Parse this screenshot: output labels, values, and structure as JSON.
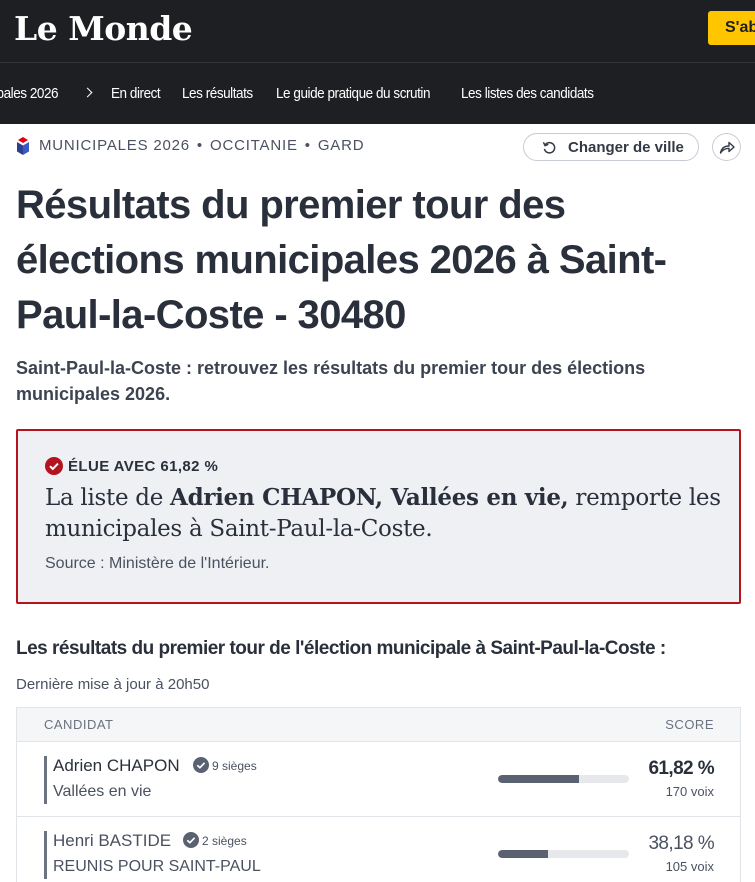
{
  "header": {
    "logo": "Le Monde",
    "subscribe_label": "S'ab"
  },
  "nav": {
    "items": [
      {
        "label": "ipales 2026"
      },
      {
        "label": "En direct"
      },
      {
        "label": "Les résultats"
      },
      {
        "label": "Le guide pratique du scrutin"
      },
      {
        "label": "Les listes des candidats"
      }
    ]
  },
  "breadcrumb": {
    "items": [
      "MUNICIPALES 2026",
      "OCCITANIE",
      "GARD"
    ],
    "separator": "•"
  },
  "actions": {
    "change_city_label": "Changer de ville"
  },
  "page": {
    "title_prefix": "Résultats du premier tour des élections municipales 2026 à ",
    "title_city": "Saint-Paul-la-Coste",
    "title_suffix": " - 30480",
    "subtitle": "Saint-Paul-la-Coste : retrouvez les résultats du premier tour des élections municipales 2026."
  },
  "elected": {
    "label": "ÉLUE AVEC 61,82 %",
    "text_prefix": "La liste de ",
    "text_bold": "Adrien CHAPON, Vallées en vie,",
    "text_suffix": " remporte les municipales à Saint-Paul-la-Coste.",
    "source": "Source : Ministère de l'Intérieur.",
    "accent_color": "#b3141d"
  },
  "results": {
    "title": "Les résultats du premier tour de l'élection municipale à Saint-Paul-la-Coste :",
    "updated": "Dernière mise à jour à 20h50",
    "columns": {
      "candidate": "CANDIDAT",
      "score": "SCORE"
    },
    "rows": [
      {
        "name": "Adrien CHAPON",
        "seats": "9 sièges",
        "list": "Vallées en vie",
        "score": "61,82 %",
        "score_fraction": 0.6182,
        "votes": "170 voix"
      },
      {
        "name": "Henri BASTIDE",
        "seats": "2 sièges",
        "list": "REUNIS POUR SAINT-PAUL",
        "score": "38,18 %",
        "score_fraction": 0.3818,
        "votes": "105 voix"
      }
    ]
  }
}
